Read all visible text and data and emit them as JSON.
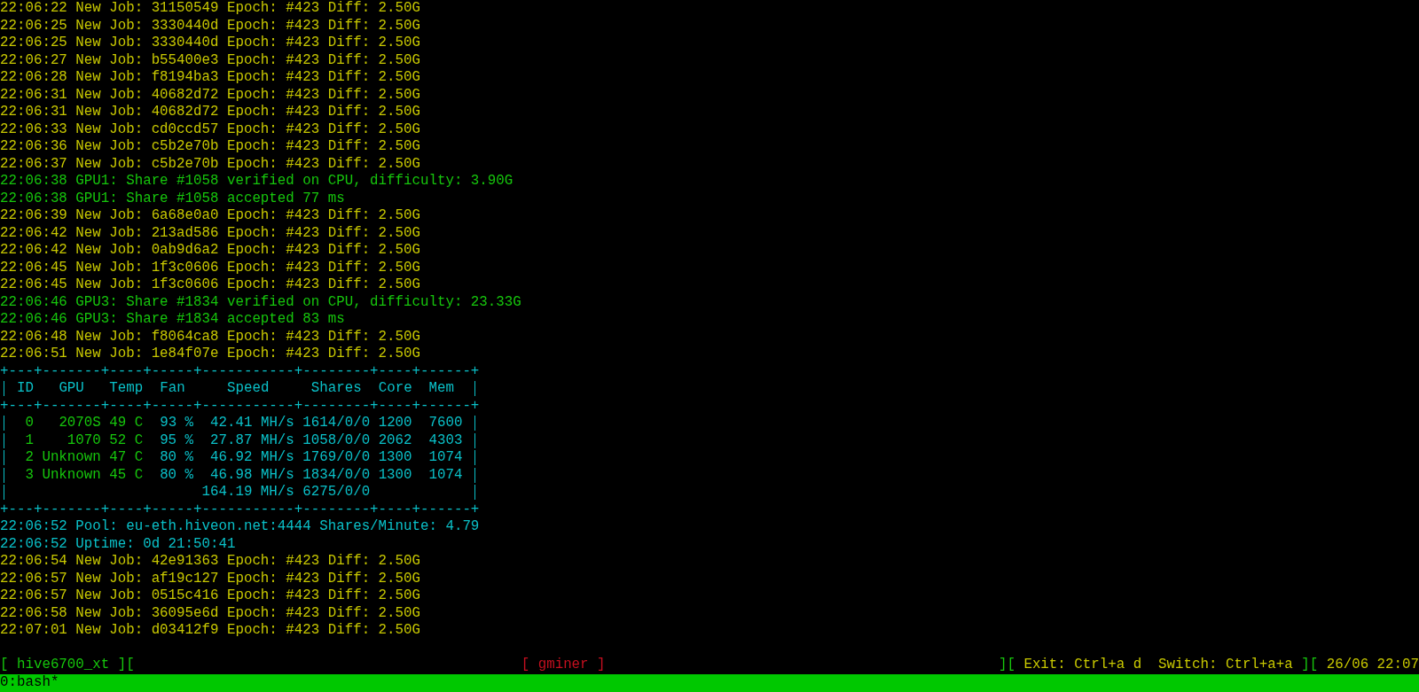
{
  "log_top": [
    {
      "kind": "job",
      "text": "22:06:22 New Job: 31150549 Epoch: #423 Diff: 2.50G"
    },
    {
      "kind": "job",
      "text": "22:06:25 New Job: 3330440d Epoch: #423 Diff: 2.50G"
    },
    {
      "kind": "job",
      "text": "22:06:25 New Job: 3330440d Epoch: #423 Diff: 2.50G"
    },
    {
      "kind": "job",
      "text": "22:06:27 New Job: b55400e3 Epoch: #423 Diff: 2.50G"
    },
    {
      "kind": "job",
      "text": "22:06:28 New Job: f8194ba3 Epoch: #423 Diff: 2.50G"
    },
    {
      "kind": "job",
      "text": "22:06:31 New Job: 40682d72 Epoch: #423 Diff: 2.50G"
    },
    {
      "kind": "job",
      "text": "22:06:31 New Job: 40682d72 Epoch: #423 Diff: 2.50G"
    },
    {
      "kind": "job",
      "text": "22:06:33 New Job: cd0ccd57 Epoch: #423 Diff: 2.50G"
    },
    {
      "kind": "job",
      "text": "22:06:36 New Job: c5b2e70b Epoch: #423 Diff: 2.50G"
    },
    {
      "kind": "job",
      "text": "22:06:37 New Job: c5b2e70b Epoch: #423 Diff: 2.50G"
    },
    {
      "kind": "share",
      "text": "22:06:38 GPU1: Share #1058 verified on CPU, difficulty: 3.90G"
    },
    {
      "kind": "share",
      "text": "22:06:38 GPU1: Share #1058 accepted 77 ms"
    },
    {
      "kind": "job",
      "text": "22:06:39 New Job: 6a68e0a0 Epoch: #423 Diff: 2.50G"
    },
    {
      "kind": "job",
      "text": "22:06:42 New Job: 213ad586 Epoch: #423 Diff: 2.50G"
    },
    {
      "kind": "job",
      "text": "22:06:42 New Job: 0ab9d6a2 Epoch: #423 Diff: 2.50G"
    },
    {
      "kind": "job",
      "text": "22:06:45 New Job: 1f3c0606 Epoch: #423 Diff: 2.50G"
    },
    {
      "kind": "job",
      "text": "22:06:45 New Job: 1f3c0606 Epoch: #423 Diff: 2.50G"
    },
    {
      "kind": "share",
      "text": "22:06:46 GPU3: Share #1834 verified on CPU, difficulty: 23.33G"
    },
    {
      "kind": "share",
      "text": "22:06:46 GPU3: Share #1834 accepted 83 ms"
    },
    {
      "kind": "job",
      "text": "22:06:48 New Job: f8064ca8 Epoch: #423 Diff: 2.50G"
    },
    {
      "kind": "job",
      "text": "22:06:51 New Job: 1e84f07e Epoch: #423 Diff: 2.50G"
    }
  ],
  "table": {
    "borders": [
      "+---+-------+----+-----+-----------+--------+----+------+",
      "+---+-------+----+-----+-----------+--------+----+------+",
      "+---+-------+----+-----+-----------+--------+----+------+"
    ],
    "columns": [
      "ID",
      "GPU",
      "Temp",
      "Fan",
      "Speed",
      "Shares",
      "Core",
      "Mem"
    ],
    "rows": [
      {
        "cells": [
          "0",
          "2070S",
          "49 C",
          "93 %",
          "42.41 MH/s",
          "1614/0/0",
          "1200",
          "7600"
        ]
      },
      {
        "cells": [
          "1",
          "1070",
          "52 C",
          "95 %",
          "27.87 MH/s",
          "1058/0/0",
          "2062",
          "4303"
        ]
      },
      {
        "cells": [
          "2",
          "Unknown",
          "47 C",
          "80 %",
          "46.92 MH/s",
          "1769/0/0",
          "1300",
          "1074"
        ]
      },
      {
        "cells": [
          "3",
          "Unknown",
          "45 C",
          "80 %",
          "46.98 MH/s",
          "1834/0/0",
          "1300",
          "1074"
        ]
      }
    ],
    "total": {
      "speed": "164.19 MH/s",
      "shares": "6275/0/0"
    }
  },
  "log_bottom": [
    {
      "kind": "info",
      "text": "22:06:52 Pool: eu-eth.hiveon.net:4444 Shares/Minute: 4.79"
    },
    {
      "kind": "info",
      "text": "22:06:52 Uptime: 0d 21:50:41"
    },
    {
      "kind": "job",
      "text": "22:06:54 New Job: 42e91363 Epoch: #423 Diff: 2.50G"
    },
    {
      "kind": "job",
      "text": "22:06:57 New Job: af19c127 Epoch: #423 Diff: 2.50G"
    },
    {
      "kind": "job",
      "text": "22:06:57 New Job: 0515c416 Epoch: #423 Diff: 2.50G"
    },
    {
      "kind": "job",
      "text": "22:06:58 New Job: 36095e6d Epoch: #423 Diff: 2.50G"
    },
    {
      "kind": "job",
      "text": "22:07:01 New Job: d03412f9 Epoch: #423 Diff: 2.50G"
    }
  ],
  "status_bar": {
    "session": "[ hive6700_xt ][",
    "window": "[ gminer ]",
    "right": [
      {
        "kind": "frame",
        "text": "]["
      },
      {
        "kind": "hint",
        "text": "Exit: Ctrl+a d"
      },
      {
        "kind": "hint",
        "text": "Switch: Ctrl+a+a"
      },
      {
        "kind": "frame",
        "text": "]["
      },
      {
        "kind": "clock",
        "text": "26/06 22:07"
      }
    ]
  },
  "window_list": {
    "label": "0:bash*"
  }
}
